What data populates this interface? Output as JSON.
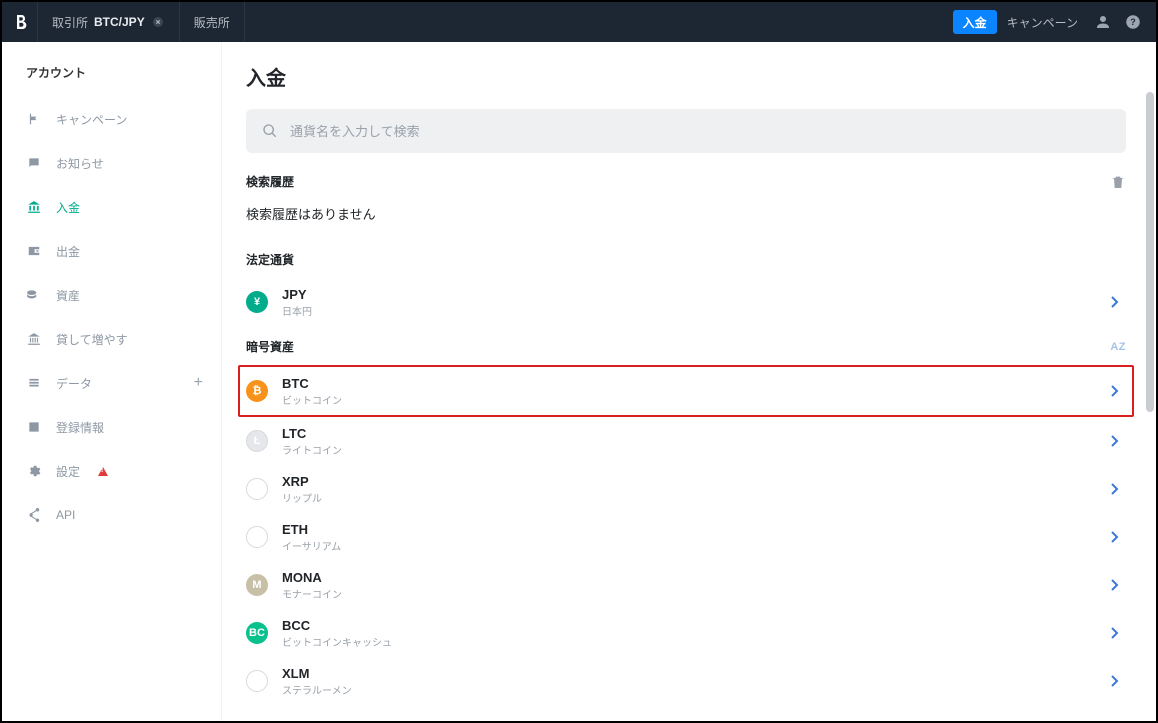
{
  "topbar": {
    "exchange_label": "取引所",
    "pair": "BTC/JPY",
    "otc_label": "販売所",
    "deposit_button": "入金",
    "campaign_link": "キャンペーン"
  },
  "sidebar": {
    "heading": "アカウント",
    "items": [
      {
        "id": "campaign",
        "label": "キャンペーン",
        "icon": "flag"
      },
      {
        "id": "notice",
        "label": "お知らせ",
        "icon": "chat"
      },
      {
        "id": "deposit",
        "label": "入金",
        "icon": "bank",
        "active": true
      },
      {
        "id": "withdraw",
        "label": "出金",
        "icon": "wallet-out"
      },
      {
        "id": "assets",
        "label": "資産",
        "icon": "coins"
      },
      {
        "id": "lending",
        "label": "貸して増やす",
        "icon": "bank2"
      },
      {
        "id": "data",
        "label": "データ",
        "icon": "stack",
        "expandable": true
      },
      {
        "id": "register",
        "label": "登録情報",
        "icon": "badge"
      },
      {
        "id": "settings",
        "label": "設定",
        "icon": "gear",
        "warning": true
      },
      {
        "id": "api",
        "label": "API",
        "icon": "share"
      }
    ]
  },
  "main": {
    "title": "入金",
    "search_placeholder": "通貨名を入力して検索",
    "history_heading": "検索履歴",
    "history_empty": "検索履歴はありません",
    "fiat_heading": "法定通貨",
    "crypto_heading": "暗号資産",
    "sort_label": "AZ",
    "fiat": [
      {
        "symbol": "JPY",
        "name": "日本円",
        "color": "c-jpy",
        "glyph": "¥"
      }
    ],
    "crypto": [
      {
        "symbol": "BTC",
        "name": "ビットコイン",
        "color": "c-btc",
        "glyph": "₿",
        "highlight": true
      },
      {
        "symbol": "LTC",
        "name": "ライトコイン",
        "color": "c-ltc",
        "glyph": "Ł"
      },
      {
        "symbol": "XRP",
        "name": "リップル",
        "color": "c-xrp",
        "glyph": "✕"
      },
      {
        "symbol": "ETH",
        "name": "イーサリアム",
        "color": "c-eth",
        "glyph": "◆"
      },
      {
        "symbol": "MONA",
        "name": "モナーコイン",
        "color": "c-mona",
        "glyph": "M"
      },
      {
        "symbol": "BCC",
        "name": "ビットコインキャッシュ",
        "color": "c-bcc",
        "glyph": "BC"
      },
      {
        "symbol": "XLM",
        "name": "ステラルーメン",
        "color": "c-xlm",
        "glyph": "✶"
      }
    ]
  }
}
